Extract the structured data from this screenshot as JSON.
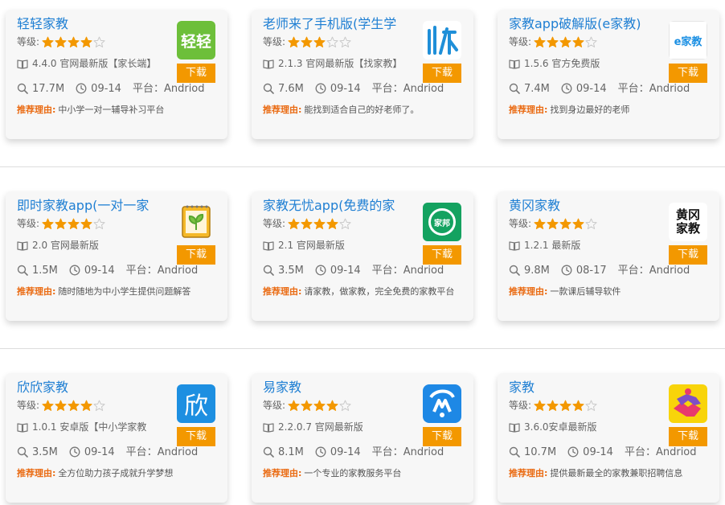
{
  "download_label": "下载",
  "rating_label": "等级:",
  "platform_label": "平台：",
  "reason_label": "推荐理由:",
  "star_color": "#f39800",
  "apps": [
    {
      "title": "轻轻家教",
      "rating": 4,
      "version": "4.4.0 官网最新版【家长端】",
      "size": "17.7M",
      "date": "09-14",
      "platform": "Andriod",
      "reason": "中小学一对一辅导补习平台",
      "icon": "qingqing-logo-icon",
      "icon_text": "轻轻"
    },
    {
      "title": "老师来了手机版(学生学",
      "rating": 3,
      "version": "2.1.3 官网最新版【找家教】",
      "size": "7.6M",
      "date": "09-14",
      "platform": "Andriod",
      "reason": "能找到适合自己的好老师了。",
      "icon": "laoshi-logo-icon",
      "icon_text": ""
    },
    {
      "title": "家教app破解版(e家教)",
      "rating": 4,
      "version": "1.5.6 官方免费版",
      "size": "7.4M",
      "date": "09-14",
      "platform": "Andriod",
      "reason": "找到身边最好的老师",
      "icon": "ejiajiao-logo-icon",
      "icon_text": "e家教"
    },
    {
      "title": "即时家教app(一对一家",
      "rating": 4,
      "version": "2.0 官网最新版",
      "size": "1.5M",
      "date": "09-14",
      "platform": "Andriod",
      "reason": "随时随地为中小学生提供问题解答",
      "icon": "notebook-sprout-icon",
      "icon_text": ""
    },
    {
      "title": "家教无忧app(免费的家",
      "rating": 4,
      "version": "2.1 官网最新版",
      "size": "3.5M",
      "date": "09-14",
      "platform": "Andriod",
      "reason": "请家教，做家教，完全免费的家教平台",
      "icon": "jiabang-logo-icon",
      "icon_text": "家邦"
    },
    {
      "title": "黄冈家教",
      "rating": 4,
      "version": "1.2.1 最新版",
      "size": "9.8M",
      "date": "08-17",
      "platform": "Andriod",
      "reason": "一款课后辅导软件",
      "icon": "huanggang-logo-icon",
      "icon_text": "黄冈家教"
    },
    {
      "title": "欣欣家教",
      "rating": 4,
      "version": "1.0.1 安卓版【中小学家教",
      "size": "3.5M",
      "date": "09-14",
      "platform": "Andriod",
      "reason": "全方位助力孩子成就升学梦想",
      "icon": "xin-logo-icon",
      "icon_text": "欣"
    },
    {
      "title": "易家教",
      "rating": 4,
      "version": "2.2.0.7 官网最新版",
      "size": "8.1M",
      "date": "09-14",
      "platform": "Andriod",
      "reason": "一个专业的家教服务平台",
      "icon": "yijiajiao-logo-icon",
      "icon_text": ""
    },
    {
      "title": "家教",
      "rating": 4,
      "version": "3.6.0安卓最新版",
      "size": "10.7M",
      "date": "09-14",
      "platform": "Andriod",
      "reason": "提供最新最全的家教兼职招聘信息",
      "icon": "handshake-logo-icon",
      "icon_text": ""
    }
  ]
}
